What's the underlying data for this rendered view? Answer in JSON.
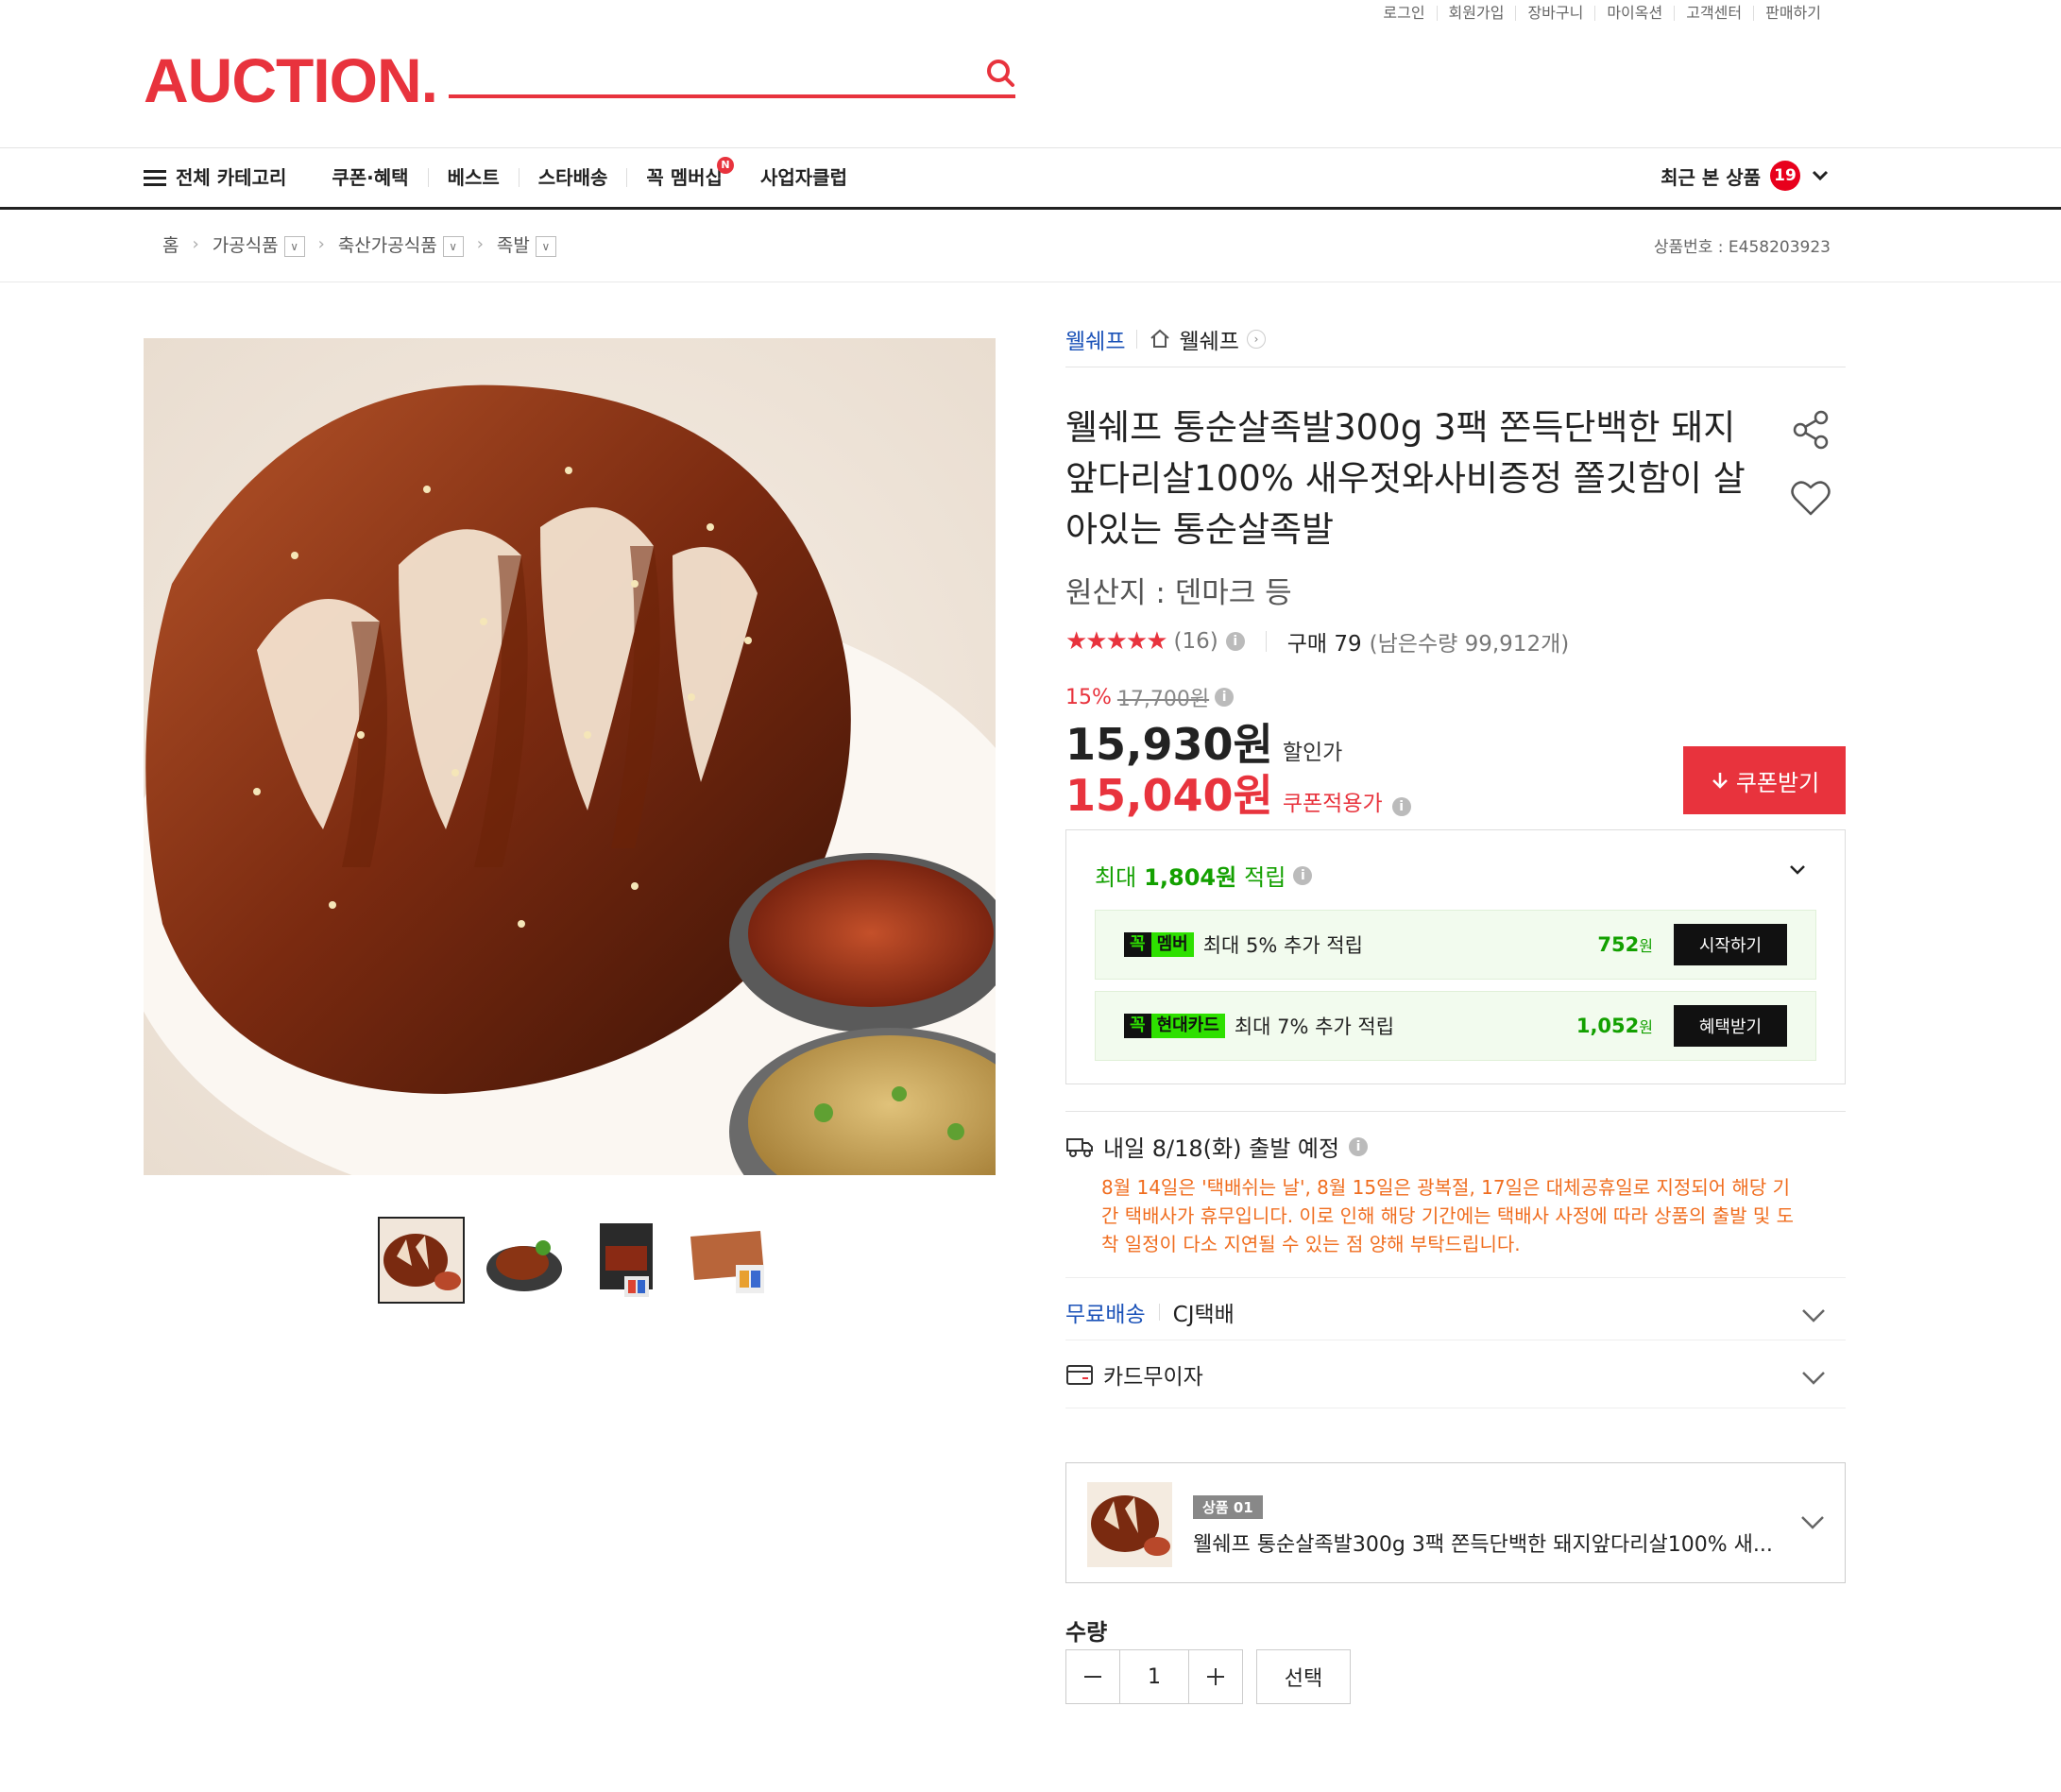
{
  "util_links": [
    "로그인",
    "회원가입",
    "장바구니",
    "마이옥션",
    "고객센터",
    "판매하기"
  ],
  "logo": "AUCTION.",
  "nav": {
    "all_category": "전체 카테고리",
    "items": [
      "쿠폰·혜택",
      "베스트",
      "스타배송",
      "꼭 멤버십",
      "사업자클럽"
    ],
    "new_badge": "N",
    "recent_label": "최근 본 상품",
    "recent_count": "19"
  },
  "breadcrumb": [
    "홈",
    "가공식품",
    "축산가공식품",
    "족발"
  ],
  "product_no": "상품번호 : E458203923",
  "brand": {
    "name": "웰쉐프",
    "store": "웰쉐프"
  },
  "product": {
    "title": "웰쉐프 통순살족발300g 3팩 쫀득단백한 돼지앞다리살100% 새우젓와사비증정 쫄깃함이 살아있는 통순살족발",
    "origin": "원산지 : 덴마크 등",
    "stars": "★★★★★",
    "review_count": "(16)",
    "purchases": "구매 79",
    "stock": "(남은수량 99,912개)",
    "discount_pct": "15%",
    "original_price": "17,700원",
    "sale_price": "15,930원",
    "sale_label": "할인가",
    "coupon_price": "15,040원",
    "coupon_label": "쿠폰적용가",
    "coupon_button": "쿠폰받기"
  },
  "points": {
    "prefix": "최대",
    "amount": "1,804원",
    "suffix": "적립",
    "rows": [
      {
        "k": "꼭",
        "badge": "멤버",
        "text": "최대 5% 추가 적립",
        "amount": "752",
        "unit": "원",
        "button": "시작하기"
      },
      {
        "k": "꼭",
        "badge": "현대카드",
        "text": "최대 7% 추가 적립",
        "amount": "1,052",
        "unit": "원",
        "button": "혜택받기"
      }
    ]
  },
  "shipping": {
    "eta": "내일 8/18(화) 출발 예정",
    "notice": "8월 14일은 '택배쉬는 날', 8월 15일은 광복절, 17일은 대체공휴일로 지정되어 해당 기간 택배사가 휴무입니다. 이로 인해 해당 기간에는 택배사 사정에 따라 상품의 출발 및 도착 일정이 다소 지연될 수 있는 점 양해 부탁드립니다.",
    "free": "무료배송",
    "carrier": "CJ택배",
    "card": "카드무이자"
  },
  "option": {
    "tag": "상품 01",
    "name": "웰쉐프 통순살족발300g 3팩 쫀득단백한 돼지앞다리살100% 새..."
  },
  "quantity": {
    "label": "수량",
    "value": "1",
    "select": "선택"
  },
  "colors": {
    "accent": "#e8333d",
    "brand_blue": "#1b52b8",
    "point_green": "#13a000",
    "notice_orange": "#f06d1f"
  }
}
